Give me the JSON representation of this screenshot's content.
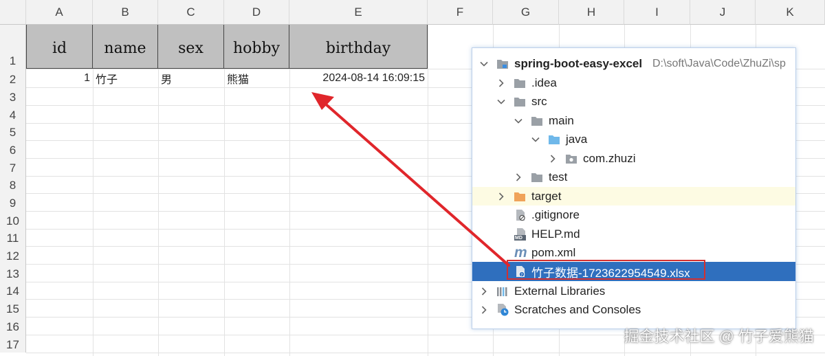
{
  "sheet": {
    "columns": [
      "A",
      "B",
      "C",
      "D",
      "E",
      "F",
      "G",
      "H",
      "I",
      "J",
      "K"
    ],
    "rows": [
      "1",
      "2",
      "3",
      "4",
      "5",
      "6",
      "7",
      "8",
      "9",
      "10",
      "11",
      "12",
      "13",
      "14",
      "15",
      "16",
      "17"
    ],
    "header": {
      "id": "id",
      "name": "name",
      "sex": "sex",
      "hobby": "hobby",
      "birthday": "birthday"
    },
    "record": {
      "id": "1",
      "name": "竹子",
      "sex": "男",
      "hobby": "熊猫",
      "birthday": "2024-08-14 16:09:15"
    },
    "header_color": "#c0c0c0"
  },
  "project": {
    "root_name": "spring-boot-easy-excel",
    "root_path": "D:\\soft\\Java\\Code\\ZhuZi\\sp",
    "idea": ".idea",
    "src": "src",
    "main": "main",
    "java": "java",
    "package": "com.zhuzi",
    "test": "test",
    "target": "target",
    "gitignore": ".gitignore",
    "help": "HELP.md",
    "pom": "pom.xml",
    "xlsx": "竹子数据-1723622954549.xlsx",
    "ext_libs": "External Libraries",
    "scratches": "Scratches and Consoles",
    "md_badge": "MD",
    "m_badge": "m",
    "selection_color": "#2f6fbe",
    "highlight_box_color": "#d32f2f",
    "arrow_color": "#e0262b"
  },
  "watermark": "掘金技术社区 @ 竹子爱熊猫"
}
